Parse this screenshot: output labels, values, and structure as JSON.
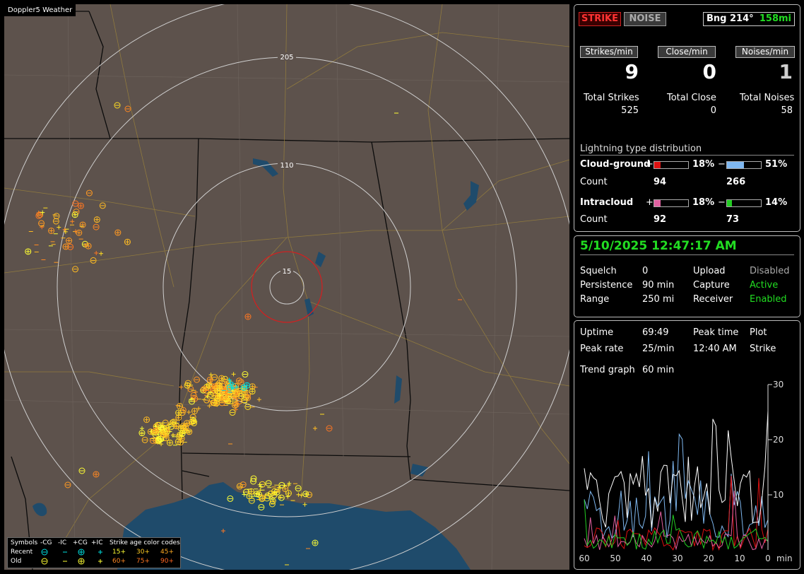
{
  "map": {
    "title": "Doppler5 Weather",
    "range_labels": [
      "205",
      "110",
      "15"
    ],
    "legend": {
      "symbols_label": "Symbols",
      "neg_cg": "-CG",
      "neg_ic": "-IC",
      "pos_cg": "+CG",
      "pos_ic": "+IC",
      "age_title": "Strike age color codes",
      "recent_label": "Recent",
      "old_label": "Old",
      "ages": [
        "15+",
        "30+",
        "45+",
        "60+",
        "75+",
        "90+"
      ]
    }
  },
  "stats": {
    "tab_strike": "STRIKE",
    "tab_noise": "NOISE",
    "bearing": "Bng 214°",
    "distance": "158mi",
    "strikes_per_min_label": "Strikes/min",
    "close_per_min_label": "Close/min",
    "noises_per_min_label": "Noises/min",
    "strikes_per_min": "9",
    "close_per_min": "0",
    "noises_per_min": "1",
    "total_strikes_label": "Total Strikes",
    "total_close_label": "Total Close",
    "total_noises_label": "Total Noises",
    "total_strikes": "525",
    "total_close": "0",
    "total_noises": "58"
  },
  "distribution": {
    "title": "Lightning type distribution",
    "cg_label": "Cloud-ground",
    "ic_label": "Intracloud",
    "count_label": "Count",
    "plus": "+",
    "minus": "−",
    "cg_pos_pct": "18%",
    "cg_neg_pct": "51%",
    "ic_pos_pct": "18%",
    "ic_neg_pct": "14%",
    "cg_pos_frac": 0.18,
    "cg_neg_frac": 0.51,
    "ic_pos_frac": 0.18,
    "ic_neg_frac": 0.14,
    "cg_pos_count": "94",
    "cg_neg_count": "266",
    "ic_pos_count": "92",
    "ic_neg_count": "73"
  },
  "status": {
    "datetime": "5/10/2025 12:47:17 AM",
    "squelch_label": "Squelch",
    "squelch": "0",
    "persistence_label": "Persistence",
    "persistence": "90 min",
    "range_label": "Range",
    "range": "250 mi",
    "upload_label": "Upload",
    "upload": "Disabled",
    "capture_label": "Capture",
    "capture": "Active",
    "receiver_label": "Receiver",
    "receiver": "Enabled"
  },
  "trend": {
    "uptime_label": "Uptime",
    "uptime": "69:49",
    "peak_time_label": "Peak time",
    "plot_label": "Plot",
    "peak_rate_label": "Peak rate",
    "peak_rate": "25/min",
    "peak_time": "12:40 AM",
    "plot": "Strike",
    "trend_graph_label": "Trend graph",
    "trend_graph": "60 min",
    "x_ticks": [
      "60",
      "50",
      "40",
      "30",
      "20",
      "10",
      "0"
    ],
    "x_unit": "min",
    "y_ticks": [
      "30",
      "20",
      "10"
    ]
  },
  "colors": {
    "green": "#22dd22",
    "strike_red": "#cc2222",
    "cg_pos": "#dd1111",
    "cg_neg": "#7fb8f0",
    "ic_pos": "#e060a0",
    "ic_neg": "#22cc22"
  }
}
